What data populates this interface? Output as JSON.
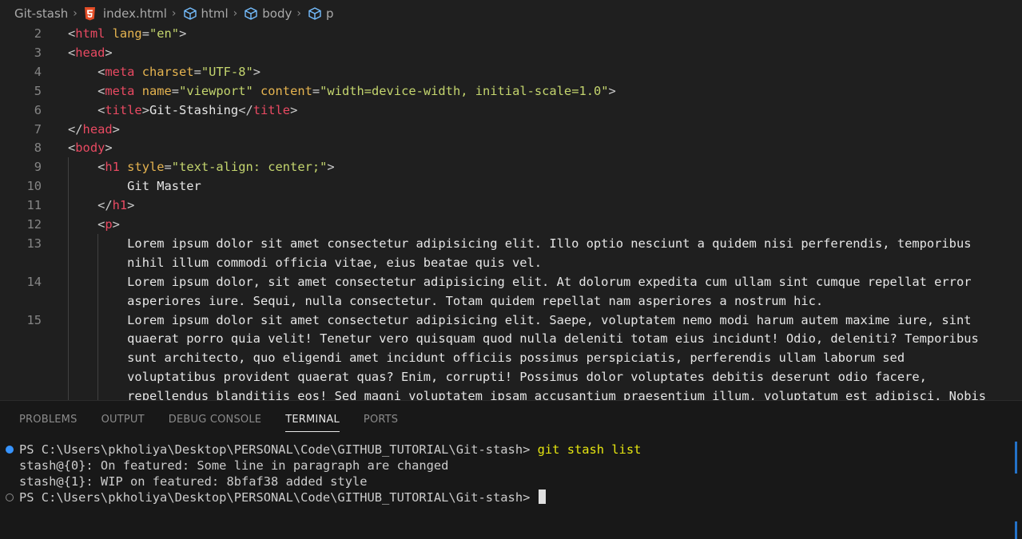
{
  "breadcrumb": {
    "items": [
      {
        "label": "Git-stash",
        "icon": "none"
      },
      {
        "label": "index.html",
        "icon": "html5-icon"
      },
      {
        "label": "html",
        "icon": "cube-icon"
      },
      {
        "label": "body",
        "icon": "cube-icon"
      },
      {
        "label": "p",
        "icon": "cube-icon"
      }
    ],
    "separator": "›"
  },
  "editor": {
    "lines": [
      {
        "num": "2",
        "tokens": [
          [
            "p",
            "<"
          ],
          [
            "t",
            "html"
          ],
          [
            "a",
            " lang"
          ],
          [
            "p",
            "="
          ],
          [
            "s",
            "\"en\""
          ],
          [
            "p",
            ">"
          ]
        ],
        "indent": 0
      },
      {
        "num": "3",
        "tokens": [
          [
            "p",
            "<"
          ],
          [
            "t",
            "head"
          ],
          [
            "p",
            ">"
          ]
        ],
        "indent": 0
      },
      {
        "num": "4",
        "tokens": [
          [
            "p",
            "<"
          ],
          [
            "t",
            "meta"
          ],
          [
            "a",
            " charset"
          ],
          [
            "p",
            "="
          ],
          [
            "s",
            "\"UTF-8\""
          ],
          [
            "p",
            ">"
          ]
        ],
        "indent": 1
      },
      {
        "num": "5",
        "tokens": [
          [
            "p",
            "<"
          ],
          [
            "t",
            "meta"
          ],
          [
            "a",
            " name"
          ],
          [
            "p",
            "="
          ],
          [
            "s",
            "\"viewport\""
          ],
          [
            "a",
            " content"
          ],
          [
            "p",
            "="
          ],
          [
            "s",
            "\"width=device-width, initial-scale=1.0\""
          ],
          [
            "p",
            ">"
          ]
        ],
        "indent": 1
      },
      {
        "num": "6",
        "tokens": [
          [
            "p",
            "<"
          ],
          [
            "t",
            "title"
          ],
          [
            "p",
            ">"
          ],
          [
            "x",
            "Git-Stashing"
          ],
          [
            "p",
            "</"
          ],
          [
            "t",
            "title"
          ],
          [
            "p",
            ">"
          ]
        ],
        "indent": 1
      },
      {
        "num": "7",
        "tokens": [
          [
            "p",
            "</"
          ],
          [
            "t",
            "head"
          ],
          [
            "p",
            ">"
          ]
        ],
        "indent": 0
      },
      {
        "num": "8",
        "tokens": [
          [
            "p",
            "<"
          ],
          [
            "t",
            "body"
          ],
          [
            "p",
            ">"
          ]
        ],
        "indent": 0
      },
      {
        "num": "9",
        "tokens": [
          [
            "p",
            "<"
          ],
          [
            "t",
            "h1"
          ],
          [
            "a",
            " style"
          ],
          [
            "p",
            "="
          ],
          [
            "s",
            "\"text-align: center;\""
          ],
          [
            "p",
            ">"
          ]
        ],
        "indent": 1
      },
      {
        "num": "10",
        "tokens": [
          [
            "x",
            "Git Master"
          ]
        ],
        "indent": 2
      },
      {
        "num": "11",
        "tokens": [
          [
            "p",
            "</"
          ],
          [
            "t",
            "h1"
          ],
          [
            "p",
            ">"
          ]
        ],
        "indent": 1
      },
      {
        "num": "12",
        "tokens": [
          [
            "p",
            "<"
          ],
          [
            "t",
            "p"
          ],
          [
            "p",
            ">"
          ]
        ],
        "indent": 1
      },
      {
        "num": "13",
        "tokens": [
          [
            "x",
            "Lorem ipsum dolor sit amet consectetur adipisicing elit. Illo optio nesciunt a quidem nisi perferendis, temporibus"
          ]
        ],
        "indent": 2
      },
      {
        "num": "",
        "tokens": [
          [
            "x",
            "nihil illum commodi officia vitae, eius beatae quis vel."
          ]
        ],
        "indent": 2
      },
      {
        "num": "14",
        "tokens": [
          [
            "x",
            "Lorem ipsum dolor, sit amet consectetur adipisicing elit. At dolorum expedita cum ullam sint cumque repellat error"
          ]
        ],
        "indent": 2
      },
      {
        "num": "",
        "tokens": [
          [
            "x",
            "asperiores iure. Sequi, nulla consectetur. Totam quidem repellat nam asperiores a nostrum hic."
          ]
        ],
        "indent": 2
      },
      {
        "num": "15",
        "tokens": [
          [
            "x",
            "Lorem ipsum dolor sit amet consectetur adipisicing elit. Saepe, voluptatem nemo modi harum autem maxime iure, sint"
          ]
        ],
        "indent": 2
      },
      {
        "num": "",
        "tokens": [
          [
            "x",
            "quaerat porro quia velit! Tenetur vero quisquam quod nulla deleniti totam eius incidunt! Odio, deleniti? Temporibus"
          ]
        ],
        "indent": 2
      },
      {
        "num": "",
        "tokens": [
          [
            "x",
            "sunt architecto, quo eligendi amet incidunt officiis possimus perspiciatis, perferendis ullam laborum sed"
          ]
        ],
        "indent": 2
      },
      {
        "num": "",
        "tokens": [
          [
            "x",
            "voluptatibus provident quaerat quas? Enim, corrupti! Possimus dolor voluptates debitis deserunt odio facere,"
          ]
        ],
        "indent": 2
      },
      {
        "num": "",
        "tokens": [
          [
            "x",
            "repellendus blanditiis eos! Sed magni voluptatem ipsam accusantium praesentium illum, voluptatum est adipisci. Nobis"
          ]
        ],
        "indent": 2
      }
    ]
  },
  "panel": {
    "tabs": [
      {
        "label": "PROBLEMS",
        "active": false
      },
      {
        "label": "OUTPUT",
        "active": false
      },
      {
        "label": "DEBUG CONSOLE",
        "active": false
      },
      {
        "label": "TERMINAL",
        "active": true
      },
      {
        "label": "PORTS",
        "active": false
      }
    ]
  },
  "terminal": {
    "prompt1": "PS C:\\Users\\pkholiya\\Desktop\\PERSONAL\\Code\\GITHUB_TUTORIAL\\Git-stash> ",
    "command1": "git stash list",
    "output1": "stash@{0}: On featured: Some line in paragraph are changed",
    "output2": "stash@{1}: WIP on featured: 8bfaf38 added style",
    "prompt2": "PS C:\\Users\\pkholiya\\Desktop\\PERSONAL\\Code\\GITHUB_TUTORIAL\\Git-stash> "
  },
  "colors": {
    "tag": "#e94a62",
    "attr": "#e6b450",
    "string": "#c4d56e",
    "accent": "#3794ff",
    "command": "#e5e510"
  }
}
